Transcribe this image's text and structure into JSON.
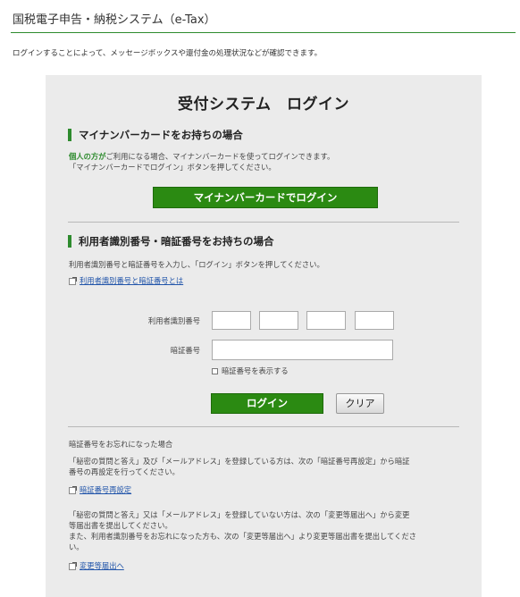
{
  "header": {
    "title": "国税電子申告・納税システム（e-Tax）"
  },
  "intro": "ログインすることによって、メッセージボックスや還付金の処理状況などが確認できます。",
  "panel": {
    "title": "受付システム　ログイン"
  },
  "mynumber": {
    "heading": "マイナンバーカードをお持ちの場合",
    "note_accent": "個人の方が",
    "note_rest": "ご利用になる場合、マイナンバーカードを使ってログインできます。",
    "note_line2": "「マイナンバーカードでログイン」ボタンを押してください。",
    "button_label": "マイナンバーカードでログイン"
  },
  "userid": {
    "heading": "利用者識別番号・暗証番号をお持ちの場合",
    "note": "利用者識別番号と暗証番号を入力し、「ログイン」ボタンを押してください。",
    "help_link": "利用者識別番号と暗証番号とは",
    "id_label": "利用者識別番号",
    "pw_label": "暗証番号",
    "show_pw_label": "暗証番号を表示する",
    "login_button": "ログイン",
    "clear_button": "クリア"
  },
  "forgot": {
    "title": "暗証番号をお忘れになった場合",
    "para1_line1": "「秘密の質問と答え」及び「メールアドレス」を登録している方は、次の「暗証番号再設定」から暗証",
    "para1_line2": "番号の再設定を行ってください。",
    "link1": "暗証番号再設定",
    "para2_line1": "「秘密の質問と答え」又は「メールアドレス」を登録していない方は、次の「変更等届出へ」から変更",
    "para2_line2": "等届出書を提出してください。",
    "para2_line3": "また、利用者識別番号をお忘れになった方も、次の「変更等届出へ」より変更等届出書を提出してくださ",
    "para2_line4": "い。",
    "link2": "変更等届出へ"
  },
  "colors": {
    "accent_green": "#2e8b2e",
    "button_green": "#2b8a12",
    "link_blue": "#2255aa",
    "panel_bg": "#ebebeb"
  },
  "icons": {
    "link": "external-link-icon",
    "checkbox": "checkbox-icon"
  }
}
